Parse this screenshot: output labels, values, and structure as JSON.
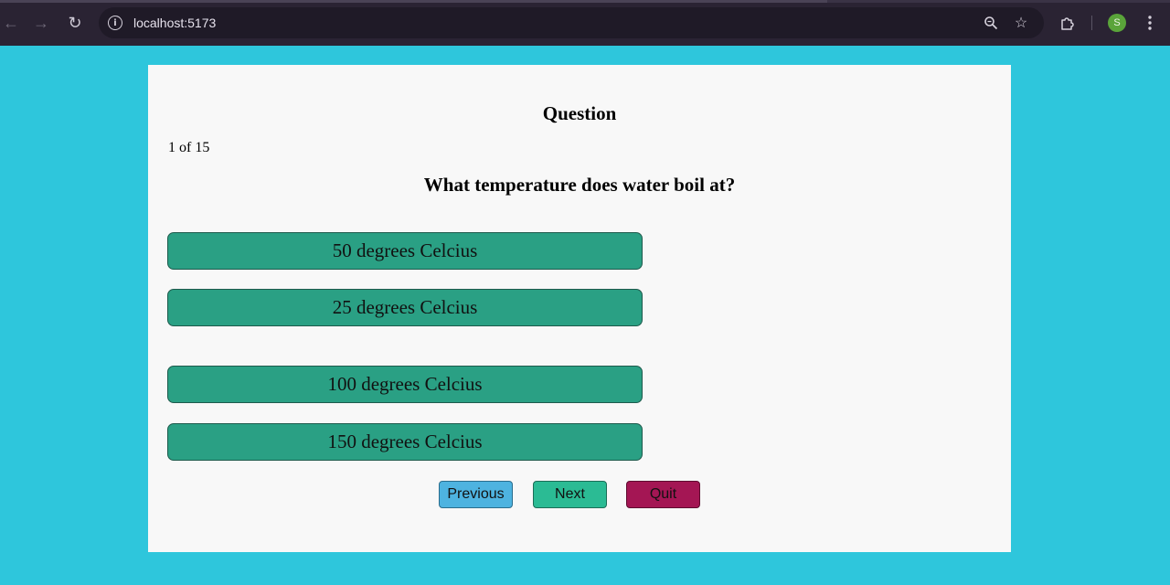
{
  "browser": {
    "url": "localhost:5173",
    "profile_initial": "S",
    "icons": [
      "back-icon",
      "forward-icon",
      "reload-icon",
      "site-info-icon",
      "zoom-icon",
      "bookmark-star-icon",
      "extensions-icon",
      "menu-icon"
    ]
  },
  "quiz": {
    "title": "Question",
    "progress": "1 of 15",
    "question": "What temperature does water boil at?",
    "options": [
      "50 degrees Celcius",
      "25 degrees Celcius",
      "100 degrees Celcius",
      "150 degrees Celcius"
    ],
    "controls": {
      "previous": "Previous",
      "next": "Next",
      "quit": "Quit"
    }
  },
  "colors": {
    "page_background": "#2ec6dc",
    "card_background": "#f8f8f8",
    "option_button": "#2aa084",
    "previous_button": "#4eb3e0",
    "next_button": "#2bbb94",
    "quit_button": "#a41654"
  }
}
